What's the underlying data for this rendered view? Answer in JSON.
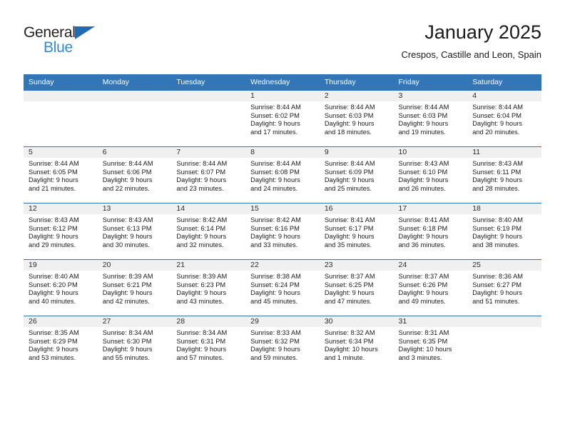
{
  "brand": {
    "line1": "General",
    "line2": "Blue",
    "triangle_color": "#1f6cb4",
    "blue_color": "#2e8bd8"
  },
  "header": {
    "title": "January 2025",
    "location": "Crespos, Castille and Leon, Spain"
  },
  "theme": {
    "header_bg": "#3276b8",
    "daynum_bg": "#f0f0f0",
    "grid_line": "#3276b8"
  },
  "weekdays": [
    "Sunday",
    "Monday",
    "Tuesday",
    "Wednesday",
    "Thursday",
    "Friday",
    "Saturday"
  ],
  "weeks": [
    [
      {
        "day": "",
        "lines": []
      },
      {
        "day": "",
        "lines": []
      },
      {
        "day": "",
        "lines": []
      },
      {
        "day": "1",
        "lines": [
          "Sunrise: 8:44 AM",
          "Sunset: 6:02 PM",
          "Daylight: 9 hours",
          "and 17 minutes."
        ]
      },
      {
        "day": "2",
        "lines": [
          "Sunrise: 8:44 AM",
          "Sunset: 6:03 PM",
          "Daylight: 9 hours",
          "and 18 minutes."
        ]
      },
      {
        "day": "3",
        "lines": [
          "Sunrise: 8:44 AM",
          "Sunset: 6:03 PM",
          "Daylight: 9 hours",
          "and 19 minutes."
        ]
      },
      {
        "day": "4",
        "lines": [
          "Sunrise: 8:44 AM",
          "Sunset: 6:04 PM",
          "Daylight: 9 hours",
          "and 20 minutes."
        ]
      }
    ],
    [
      {
        "day": "5",
        "lines": [
          "Sunrise: 8:44 AM",
          "Sunset: 6:05 PM",
          "Daylight: 9 hours",
          "and 21 minutes."
        ]
      },
      {
        "day": "6",
        "lines": [
          "Sunrise: 8:44 AM",
          "Sunset: 6:06 PM",
          "Daylight: 9 hours",
          "and 22 minutes."
        ]
      },
      {
        "day": "7",
        "lines": [
          "Sunrise: 8:44 AM",
          "Sunset: 6:07 PM",
          "Daylight: 9 hours",
          "and 23 minutes."
        ]
      },
      {
        "day": "8",
        "lines": [
          "Sunrise: 8:44 AM",
          "Sunset: 6:08 PM",
          "Daylight: 9 hours",
          "and 24 minutes."
        ]
      },
      {
        "day": "9",
        "lines": [
          "Sunrise: 8:44 AM",
          "Sunset: 6:09 PM",
          "Daylight: 9 hours",
          "and 25 minutes."
        ]
      },
      {
        "day": "10",
        "lines": [
          "Sunrise: 8:43 AM",
          "Sunset: 6:10 PM",
          "Daylight: 9 hours",
          "and 26 minutes."
        ]
      },
      {
        "day": "11",
        "lines": [
          "Sunrise: 8:43 AM",
          "Sunset: 6:11 PM",
          "Daylight: 9 hours",
          "and 28 minutes."
        ]
      }
    ],
    [
      {
        "day": "12",
        "lines": [
          "Sunrise: 8:43 AM",
          "Sunset: 6:12 PM",
          "Daylight: 9 hours",
          "and 29 minutes."
        ]
      },
      {
        "day": "13",
        "lines": [
          "Sunrise: 8:43 AM",
          "Sunset: 6:13 PM",
          "Daylight: 9 hours",
          "and 30 minutes."
        ]
      },
      {
        "day": "14",
        "lines": [
          "Sunrise: 8:42 AM",
          "Sunset: 6:14 PM",
          "Daylight: 9 hours",
          "and 32 minutes."
        ]
      },
      {
        "day": "15",
        "lines": [
          "Sunrise: 8:42 AM",
          "Sunset: 6:16 PM",
          "Daylight: 9 hours",
          "and 33 minutes."
        ]
      },
      {
        "day": "16",
        "lines": [
          "Sunrise: 8:41 AM",
          "Sunset: 6:17 PM",
          "Daylight: 9 hours",
          "and 35 minutes."
        ]
      },
      {
        "day": "17",
        "lines": [
          "Sunrise: 8:41 AM",
          "Sunset: 6:18 PM",
          "Daylight: 9 hours",
          "and 36 minutes."
        ]
      },
      {
        "day": "18",
        "lines": [
          "Sunrise: 8:40 AM",
          "Sunset: 6:19 PM",
          "Daylight: 9 hours",
          "and 38 minutes."
        ]
      }
    ],
    [
      {
        "day": "19",
        "lines": [
          "Sunrise: 8:40 AM",
          "Sunset: 6:20 PM",
          "Daylight: 9 hours",
          "and 40 minutes."
        ]
      },
      {
        "day": "20",
        "lines": [
          "Sunrise: 8:39 AM",
          "Sunset: 6:21 PM",
          "Daylight: 9 hours",
          "and 42 minutes."
        ]
      },
      {
        "day": "21",
        "lines": [
          "Sunrise: 8:39 AM",
          "Sunset: 6:23 PM",
          "Daylight: 9 hours",
          "and 43 minutes."
        ]
      },
      {
        "day": "22",
        "lines": [
          "Sunrise: 8:38 AM",
          "Sunset: 6:24 PM",
          "Daylight: 9 hours",
          "and 45 minutes."
        ]
      },
      {
        "day": "23",
        "lines": [
          "Sunrise: 8:37 AM",
          "Sunset: 6:25 PM",
          "Daylight: 9 hours",
          "and 47 minutes."
        ]
      },
      {
        "day": "24",
        "lines": [
          "Sunrise: 8:37 AM",
          "Sunset: 6:26 PM",
          "Daylight: 9 hours",
          "and 49 minutes."
        ]
      },
      {
        "day": "25",
        "lines": [
          "Sunrise: 8:36 AM",
          "Sunset: 6:27 PM",
          "Daylight: 9 hours",
          "and 51 minutes."
        ]
      }
    ],
    [
      {
        "day": "26",
        "lines": [
          "Sunrise: 8:35 AM",
          "Sunset: 6:29 PM",
          "Daylight: 9 hours",
          "and 53 minutes."
        ]
      },
      {
        "day": "27",
        "lines": [
          "Sunrise: 8:34 AM",
          "Sunset: 6:30 PM",
          "Daylight: 9 hours",
          "and 55 minutes."
        ]
      },
      {
        "day": "28",
        "lines": [
          "Sunrise: 8:34 AM",
          "Sunset: 6:31 PM",
          "Daylight: 9 hours",
          "and 57 minutes."
        ]
      },
      {
        "day": "29",
        "lines": [
          "Sunrise: 8:33 AM",
          "Sunset: 6:32 PM",
          "Daylight: 9 hours",
          "and 59 minutes."
        ]
      },
      {
        "day": "30",
        "lines": [
          "Sunrise: 8:32 AM",
          "Sunset: 6:34 PM",
          "Daylight: 10 hours",
          "and 1 minute."
        ]
      },
      {
        "day": "31",
        "lines": [
          "Sunrise: 8:31 AM",
          "Sunset: 6:35 PM",
          "Daylight: 10 hours",
          "and 3 minutes."
        ]
      },
      {
        "day": "",
        "lines": []
      }
    ]
  ]
}
